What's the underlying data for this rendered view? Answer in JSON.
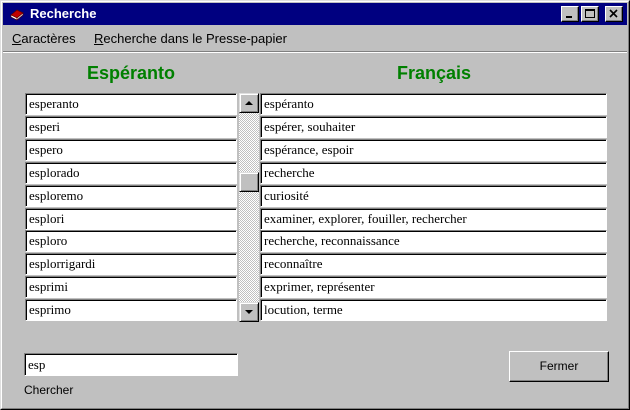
{
  "window": {
    "title": "Recherche",
    "icon": "red-book-icon",
    "buttons": [
      "minimize-icon",
      "maximize-icon",
      "close-icon"
    ]
  },
  "menu": [
    {
      "underline": "C",
      "rest": "aractères"
    },
    {
      "underline": "R",
      "rest": "echerche dans le Presse-papier"
    }
  ],
  "headers": {
    "left": "Espéranto",
    "right": "Français"
  },
  "rows": [
    {
      "eo": "esperanto",
      "fr": "espéranto"
    },
    {
      "eo": "esperi",
      "fr": "espérer, souhaiter"
    },
    {
      "eo": "espero",
      "fr": "espérance, espoir"
    },
    {
      "eo": "esplorado",
      "fr": "recherche"
    },
    {
      "eo": "esploremo",
      "fr": "curiosité"
    },
    {
      "eo": "esplori",
      "fr": "examiner, explorer, fouiller, rechercher"
    },
    {
      "eo": "esploro",
      "fr": "recherche, reconnaissance"
    },
    {
      "eo": "esplorrigardi",
      "fr": "reconnaître"
    },
    {
      "eo": "esprimi",
      "fr": "exprimer, représenter"
    },
    {
      "eo": "esprimo",
      "fr": "locution, terme"
    }
  ],
  "scroll_position": 0.35,
  "search": {
    "value": "esp",
    "label": "Chercher"
  },
  "close_button": "Fermer",
  "colors": {
    "titlebar": "#000080",
    "header": "#008000",
    "face": "#c0c0c0"
  }
}
